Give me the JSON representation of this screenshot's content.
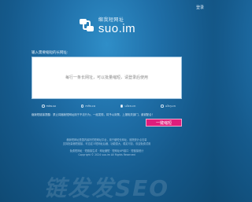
{
  "header": {
    "login_label": "登录"
  },
  "brand": {
    "name_cn": "缩我短网址",
    "name_en": "suo.im"
  },
  "form": {
    "input_label": "输入需要缩短的长网址:",
    "textarea_placeholder": "每行一条长网址，可以批量缩短，请登录后使用",
    "domain_options": [
      {
        "label": "mtw.so",
        "selected": false
      },
      {
        "label": "m9v.co",
        "selected": false
      },
      {
        "label": "u3cn.cn",
        "selected": true
      },
      {
        "label": "u3cy.cn",
        "selected": false
      }
    ],
    "notice_text": "缩我短链接提醒：禁止将缩我短网址用于不法行为，一经发现，将予以封禁，上报相关部门，谢谢配合！",
    "submit_label": "一键缩短"
  },
  "footer": {
    "lines": [
      "缩我短网址是国内最好的短网址平台，用于缩短长网址，追踪统计点击量",
      "支持批量缩短链接，可自定义短网址后缀，功能强大，稳定可靠，欢迎免费试用",
      "免费短网址 · 短链接生成 · 网址缩短 · 短网址API接口 · 短链接统计",
      "Copyright © 2024 suo.im All Rights Reserved"
    ]
  },
  "watermark": {
    "text": "链发发SEO"
  },
  "colors": {
    "background": "#1f6fa8",
    "accent_button": "#e01d7c"
  }
}
